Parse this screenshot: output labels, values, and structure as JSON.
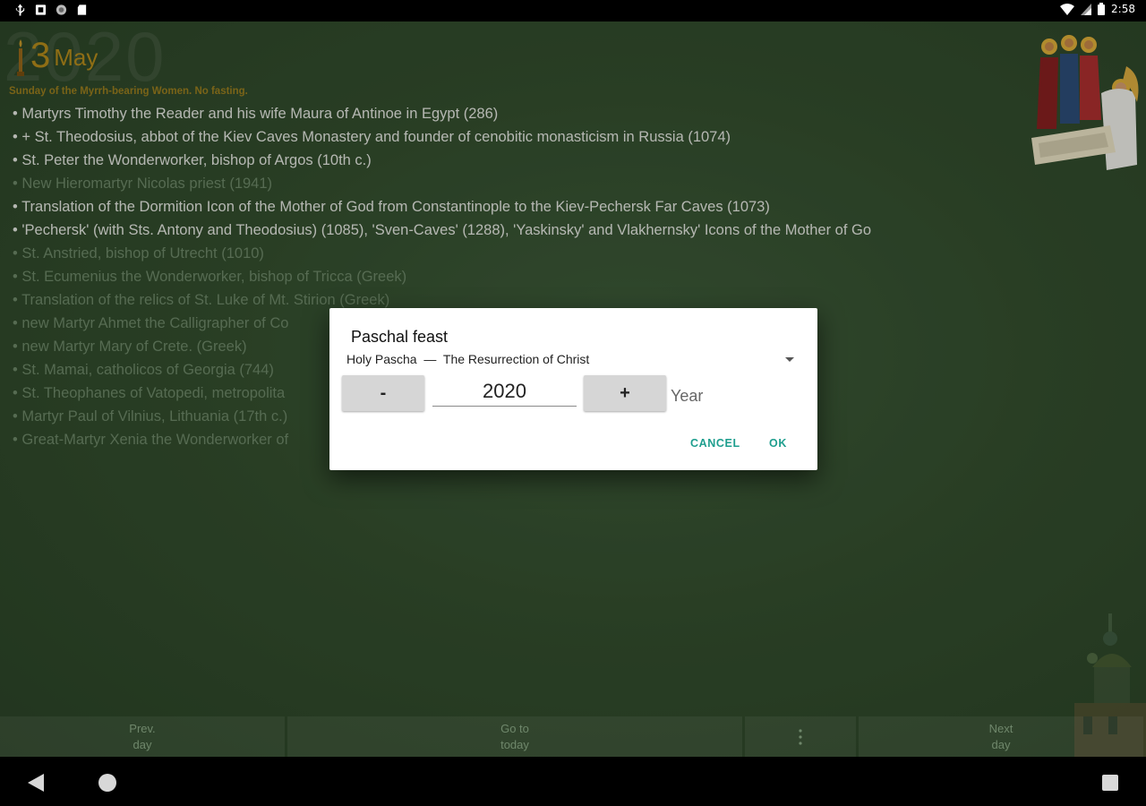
{
  "status_bar": {
    "time": "2:58",
    "left_icons": [
      "usb-icon",
      "notification-icon",
      "shield-icon",
      "sd-card-icon"
    ],
    "right_icons": [
      "wifi-icon",
      "signal-icon",
      "battery-icon"
    ]
  },
  "calendar": {
    "year": "2020",
    "day": "3",
    "month": "May",
    "day_title": "Sunday of the Myrrh-bearing Women. No fasting.",
    "saints": [
      {
        "text": "Martyrs Timothy the Reader and his wife Maura of Antinoe in Egypt (286)",
        "major": true
      },
      {
        "text": "+ St. Theodosius, abbot of the Kiev Caves Monastery and founder of cenobitic monasticism in Russia (1074)",
        "major": true
      },
      {
        "text": "St. Peter the Wonderworker, bishop of Argos (10th c.)",
        "major": true
      },
      {
        "text": "New Hieromartyr Nicolas priest (1941)",
        "major": false
      },
      {
        "text": "Translation of the Dormition Icon of the Mother of God from Constantinople to the Kiev-Pechersk Far Caves (1073)",
        "major": true
      },
      {
        "text": "'Pechersk' (with Sts. Antony and Theodosius) (1085), 'Sven-Caves' (1288), 'Yaskinsky' and Vlakhernsky' Icons of the Mother of Go",
        "major": true
      },
      {
        "text": "St. Anstried, bishop of Utrecht (1010)",
        "major": false
      },
      {
        "text": "St. Ecumenius the Wonderworker, bishop of Tricca (Greek)",
        "major": false
      },
      {
        "text": "Translation of the relics of St. Luke of Mt. Stirion (Greek)",
        "major": false
      },
      {
        "text": "new Martyr Ahmet the Calligrapher of Co",
        "major": false
      },
      {
        "text": "new Martyr Mary of Crete. (Greek)",
        "major": false
      },
      {
        "text": "St. Mamai, catholicos of Georgia (744)",
        "major": false
      },
      {
        "text": "St. Theophanes of Vatopedi, metropolita",
        "major": false
      },
      {
        "text": "Martyr Paul of Vilnius, Lithuania (17th c.)",
        "major": false
      },
      {
        "text": "Great-Martyr Xenia the Wonderworker of",
        "major": false
      }
    ]
  },
  "toolbar": {
    "prev_day": "Prev.\nday",
    "go_today": "Go to\ntoday",
    "more_icon": "more-vert-icon",
    "next_day": "Next\nday"
  },
  "dialog": {
    "title": "Paschal feast",
    "spinner_value": "Holy Pascha  —  The Resurrection of Christ",
    "minus_label": "-",
    "year_value": "2020",
    "plus_label": "+",
    "year_label": "Year",
    "cancel_label": "CANCEL",
    "ok_label": "OK"
  },
  "colors": {
    "background_green": "#35502f",
    "accent_gold": "#b88d1c",
    "dialog_button": "#1e9e8e"
  }
}
